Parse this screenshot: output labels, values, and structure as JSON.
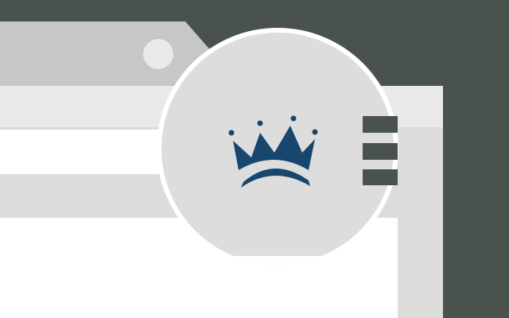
{
  "illustration": {
    "kind": "browser-extension-promo",
    "colors": {
      "background": "#4a524d",
      "browser_tab": "#c6c7c6",
      "browser_frame": "#dcdcdb",
      "toolbar": "#e8e9e8",
      "address_bar": "#ffffff",
      "content": "#ffffff",
      "lens_fill": "#dcdddc",
      "lens_ring": "#ffffff",
      "crown": "#17466e",
      "menu_icon": "#4a524d"
    },
    "icons": {
      "magnifier": "magnifier-icon",
      "crown": "crown-icon",
      "menu": "hamburger-menu-icon",
      "tab_dot": "tab-indicator-icon"
    }
  }
}
